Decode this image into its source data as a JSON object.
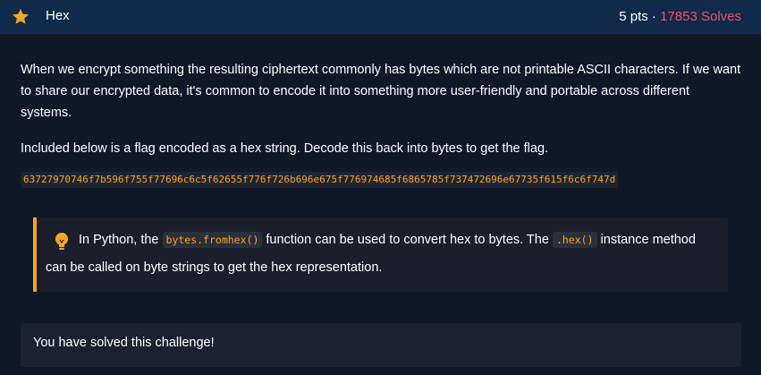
{
  "challenge": {
    "title": "Hex",
    "points": "5 pts",
    "separator": " · ",
    "solves": "17853 Solves"
  },
  "description": {
    "paragraph1": "When we encrypt something the resulting ciphertext commonly has bytes which are not printable ASCII characters. If we want to share our encrypted data, it's common to encode it into something more user-friendly and portable across different systems.",
    "paragraph2": "Included below is a flag encoded as a hex string. Decode this back into bytes to get the flag.",
    "hex_string": "63727970746f7b596f755f77696c6c5f62655f776f726b696e675f776974685f6865785f737472696e67735f615f6c6f747d"
  },
  "hint": {
    "icon": "lightbulb-icon",
    "text_before": "In Python, the ",
    "code1": "bytes.fromhex()",
    "text_middle": " function can be used to convert hex to bytes. The ",
    "code2": ".hex()",
    "text_after": " instance method",
    "line2": "can be called on byte strings to get the hex representation."
  },
  "status": {
    "message": "You have solved this challenge!"
  },
  "colors": {
    "header_bg": "#0f2a4a",
    "page_bg": "#111827",
    "accent": "#f5a623",
    "solves": "#f0506e"
  }
}
